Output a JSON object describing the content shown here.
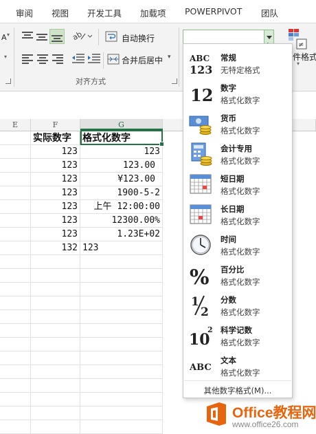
{
  "ribbon_tabs": [
    "审阅",
    "视图",
    "开发工具",
    "加载项",
    "POWERPIVOT",
    "团队"
  ],
  "alignment_group": {
    "wrap_text_label": "自动换行",
    "merge_center_label": "合并后居中",
    "group_label": "对齐方式"
  },
  "font_group": {
    "font_size_glyph": "A"
  },
  "styles_group": {
    "cond_format_label": "件格式"
  },
  "number_format_combo": {
    "value": ""
  },
  "columns": [
    "E",
    "F",
    "G"
  ],
  "table": {
    "headers": [
      "实际数字",
      "格式化数字"
    ],
    "rows": [
      [
        "123",
        "123"
      ],
      [
        "123",
        "123.00"
      ],
      [
        "123",
        "¥123.00"
      ],
      [
        "123",
        "1900-5-2"
      ],
      [
        "123",
        "上午 12:00:00"
      ],
      [
        "123",
        "12300.00%"
      ],
      [
        "123",
        "1.23E+02"
      ],
      [
        "132",
        "123"
      ]
    ]
  },
  "format_menu": {
    "items": [
      {
        "title": "常规",
        "subtitle": "无特定格式",
        "icon": "abc-123-icon",
        "glyph_top": "ABC",
        "glyph_bottom": "123"
      },
      {
        "title": "数字",
        "subtitle": "格式化数字",
        "icon": "number-12-icon",
        "glyph": "12"
      },
      {
        "title": "货币",
        "subtitle": "格式化数字",
        "icon": "currency-icon"
      },
      {
        "title": "会计专用",
        "subtitle": "格式化数字",
        "icon": "accounting-icon"
      },
      {
        "title": "短日期",
        "subtitle": "格式化数字",
        "icon": "short-date-calendar-icon"
      },
      {
        "title": "长日期",
        "subtitle": "格式化数字",
        "icon": "long-date-calendar-icon"
      },
      {
        "title": "时间",
        "subtitle": "格式化数字",
        "icon": "clock-icon"
      },
      {
        "title": "百分比",
        "subtitle": "格式化数字",
        "icon": "percent-icon",
        "glyph": "%"
      },
      {
        "title": "分数",
        "subtitle": "格式化数字",
        "icon": "fraction-icon",
        "glyph_num": "1",
        "glyph_den": "2"
      },
      {
        "title": "科学记数",
        "subtitle": "格式化数字",
        "icon": "scientific-icon",
        "glyph": "10",
        "glyph_exp": "2"
      },
      {
        "title": "文本",
        "subtitle": "格式化数字",
        "icon": "text-abc-icon",
        "glyph": "ABC"
      }
    ],
    "more_formats_label": "其他数字格式(M)..."
  },
  "watermark": {
    "line1": "Office教程网",
    "line2": "www.office26.com"
  },
  "colors": {
    "excel_green": "#217346",
    "watermark_orange": "#e8650f"
  }
}
